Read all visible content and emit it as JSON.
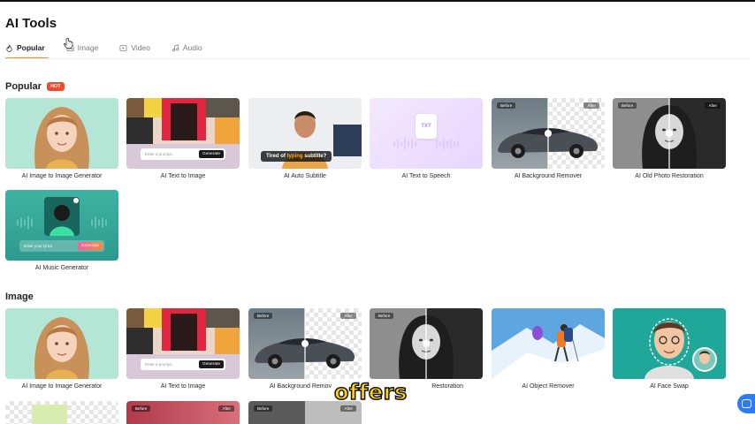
{
  "page": {
    "title": "AI Tools"
  },
  "tabs": [
    {
      "label": "Popular",
      "icon": "flame-icon",
      "active": true
    },
    {
      "label": "Image",
      "icon": "image-icon",
      "active": false
    },
    {
      "label": "Video",
      "icon": "video-icon",
      "active": false
    },
    {
      "label": "Audio",
      "icon": "music-icon",
      "active": false
    }
  ],
  "popular": {
    "heading": "Popular",
    "badge": "HOT",
    "cards": [
      {
        "label": "AI Image to Image Generator"
      },
      {
        "label": "AI Text to Image",
        "prompt_placeholder": "Enter a prompt...",
        "button": "Generate"
      },
      {
        "label": "AI Auto Subtitle",
        "caption_pre": "Tired of ",
        "caption_hl": "typing",
        "caption_post": " subtitle?"
      },
      {
        "label": "AI Text to Speech",
        "badge": "TXT"
      },
      {
        "label": "AI Background Remover",
        "before": "Before",
        "after": "After"
      },
      {
        "label": "AI Old Photo Restoration",
        "before": "Before",
        "after": "After"
      },
      {
        "label": "AI Music Generator",
        "prompt_placeholder": "Enter your lyrics",
        "button": "Generate"
      }
    ]
  },
  "image_section": {
    "heading": "Image",
    "cards": [
      {
        "label": "AI Image to Image Generator"
      },
      {
        "label": "AI Text to Image",
        "prompt_placeholder": "Enter a prompt...",
        "button": "Generate"
      },
      {
        "label": "AI Background Remov",
        "before": "Before",
        "after": "After"
      },
      {
        "label": "Restoration",
        "before": "Before"
      },
      {
        "label": "AI Object Remover"
      },
      {
        "label": "AI Face Swap"
      }
    ],
    "row3_tags": [
      "Before",
      "After",
      "Before",
      "After"
    ]
  },
  "overlay": {
    "subtitle": "offers"
  },
  "colors": {
    "accent": "#f28c28",
    "hot": "#ef4b2a",
    "chat": "#2d7cf6"
  }
}
